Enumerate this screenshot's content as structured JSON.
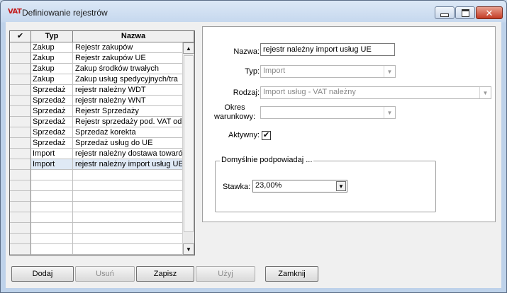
{
  "window": {
    "icon_text": "VAT",
    "title": "Definiowanie rejestrów"
  },
  "grid": {
    "columns": [
      "✔",
      "Typ",
      "Nazwa"
    ],
    "rows": [
      {
        "typ": "Zakup",
        "nazwa": "Rejestr zakupów"
      },
      {
        "typ": "Zakup",
        "nazwa": "Rejestr zakupów UE"
      },
      {
        "typ": "Zakup",
        "nazwa": "Zakup środków trwałych"
      },
      {
        "typ": "Zakup",
        "nazwa": "Zakup usług spedycyjnych/tra"
      },
      {
        "typ": "Sprzedaż",
        "nazwa": "rejestr należny WDT"
      },
      {
        "typ": "Sprzedaż",
        "nazwa": "rejestr należny WNT"
      },
      {
        "typ": "Sprzedaż",
        "nazwa": "Rejestr Sprzedaży"
      },
      {
        "typ": "Sprzedaż",
        "nazwa": "Rejestr sprzedaży pod. VAT odr"
      },
      {
        "typ": "Sprzedaż",
        "nazwa": "Sprzedaż korekta"
      },
      {
        "typ": "Sprzedaż",
        "nazwa": "Sprzedaż usług do UE"
      },
      {
        "typ": "Import",
        "nazwa": "rejestr należny dostawa towaró"
      },
      {
        "typ": "Import",
        "nazwa": "rejestr należny import usług UE"
      }
    ],
    "selected_index": 11
  },
  "form": {
    "nazwa_label": "Nazwa:",
    "nazwa_value": "rejestr należny import usług UE",
    "typ_label": "Typ:",
    "typ_value": "Import",
    "rodzaj_label": "Rodzaj:",
    "rodzaj_value": "Import usług - VAT należny",
    "okres_label_1": "Okres",
    "okres_label_2": "warunkowy:",
    "okres_value": "",
    "aktywny_label": "Aktywny:",
    "aktywny_checked": "✔",
    "group_title": "Domyślnie podpowiadaj ...",
    "stawka_label": "Stawka:",
    "stawka_value": "23,00%"
  },
  "buttons": {
    "dodaj": "Dodaj",
    "usun": "Usuń",
    "zapisz": "Zapisz",
    "uzyj": "Użyj",
    "zamknij": "Zamknij"
  }
}
